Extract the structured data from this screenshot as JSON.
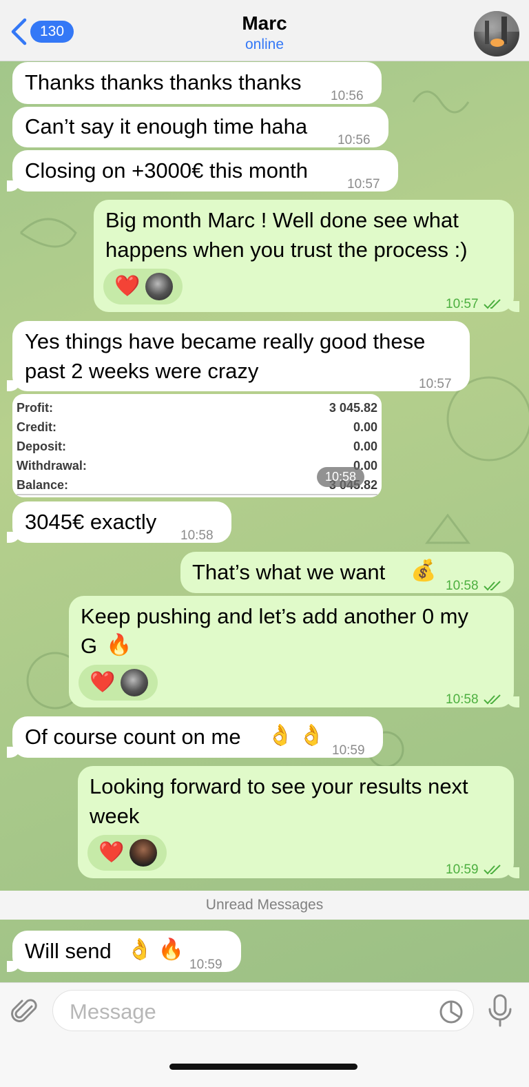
{
  "header": {
    "back_count": "130",
    "contact_name": "Marc",
    "status": "online"
  },
  "messages": [
    {
      "dir": "in",
      "text": "Thanks thanks thanks thanks",
      "time": "10:56"
    },
    {
      "dir": "in",
      "text": "Can’t say it enough time haha",
      "time": "10:56"
    },
    {
      "dir": "in",
      "text": "Closing on +3000€ this month",
      "time": "10:57"
    },
    {
      "dir": "out",
      "line1": "Big month Marc ! Well done see what",
      "line2": "happens when you trust the process :)",
      "time": "10:57",
      "reaction": "❤️"
    },
    {
      "dir": "in",
      "line1": "Yes things have became really good these",
      "line2": "past 2 weeks were crazy",
      "time": "10:57"
    },
    {
      "dir": "in",
      "text": "3045€ exactly",
      "time": "10:58"
    },
    {
      "dir": "out",
      "text": "That’s what we want",
      "emoji": "💰",
      "time": "10:58"
    },
    {
      "dir": "out",
      "line1": "Keep pushing and let’s add another 0 my",
      "line2": "G",
      "emoji": "🔥",
      "time": "10:58",
      "reaction": "❤️"
    },
    {
      "dir": "in",
      "text": "Of course count on me",
      "emoji": "👌 👌",
      "time": "10:59"
    },
    {
      "dir": "out",
      "line1": "Looking forward to see your results next",
      "line2": "week",
      "time": "10:59",
      "reaction": "❤️"
    },
    {
      "dir": "in",
      "text": "Will send",
      "emoji": "👌 🔥",
      "time": "10:59"
    }
  ],
  "statement": {
    "rows": [
      {
        "label": "Profit:",
        "value": "3 045.82"
      },
      {
        "label": "Credit:",
        "value": "0.00"
      },
      {
        "label": "Deposit:",
        "value": "0.00"
      },
      {
        "label": "Withdrawal:",
        "value": "0.00"
      },
      {
        "label": "Balance:",
        "value": "3 045.82"
      }
    ],
    "time": "10:58"
  },
  "unread_label": "Unread Messages",
  "composer": {
    "placeholder": "Message"
  },
  "colors": {
    "accent": "#3478f6",
    "outgoing_bubble": "#e0fac9",
    "incoming_bubble": "#ffffff",
    "read_time": "#4caf3f"
  },
  "icons": [
    "back-chevron-icon",
    "paperclip-icon",
    "sticker-icon",
    "microphone-icon",
    "double-check-icon",
    "heart-icon"
  ]
}
